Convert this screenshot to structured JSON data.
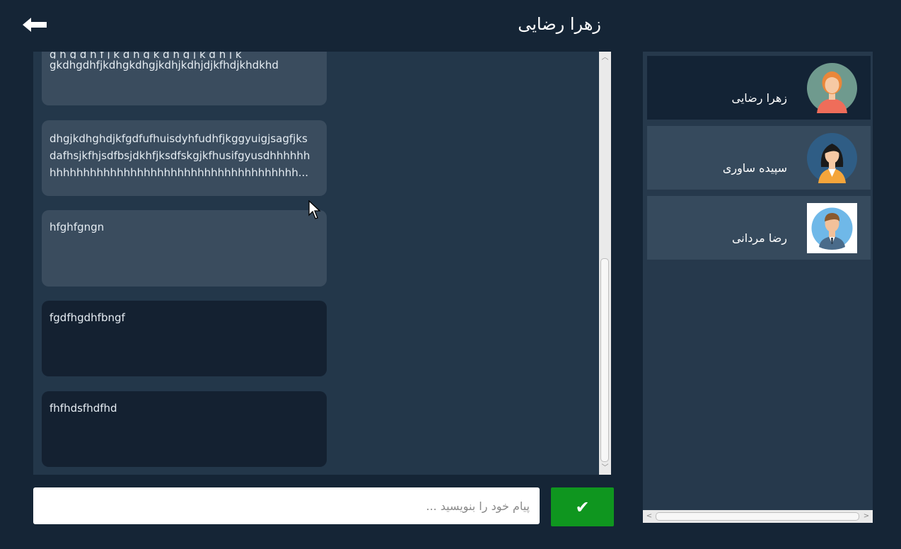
{
  "header": {
    "back_icon": "left-arrow-icon",
    "title": "زهرا رضایی"
  },
  "messages": [
    {
      "direction": "in",
      "text": "gkdhgdhfjkdhgkdhgjkdhjkdhjdjkfhdjkhdkhd"
    },
    {
      "direction": "in",
      "text": "dhgjkdhghdjkfgdfufhuisdyhfudhfjkggyuigjsagfjks\ndafhsjkfhjsdfbsjdkhfjksdfskgjkfhusifgyusdhhhhhh\nhhhhhhhhhhhhhhhhhhhhhhhhhhhhhhhhhhhhh..."
    },
    {
      "direction": "in",
      "text": "hfghfgngn"
    },
    {
      "direction": "out",
      "text": "fgdfhgdhfbngf"
    },
    {
      "direction": "out",
      "text": "fhfhdsfhdfhd"
    }
  ],
  "composer": {
    "placeholder": "پیام خود را بنویسید ...",
    "value": "",
    "send_icon": "checkmark-icon",
    "send_label": "✔"
  },
  "contacts": [
    {
      "name": "زهرا رضایی",
      "avatar": "woman-avatar-icon",
      "active": true
    },
    {
      "name": "سپیده ساوری",
      "avatar": "woman-dark-hair-avatar-icon",
      "active": false
    },
    {
      "name": "رضا مردانی",
      "avatar": "man-avatar-icon",
      "active": false
    }
  ],
  "colors": {
    "background": "#152536",
    "chat_panel": "#23374a",
    "incoming_bubble": "#3a4c5e",
    "outgoing_bubble": "#142131",
    "send_button": "#0f961f",
    "active_contact": "#132335",
    "contact": "#364a5d"
  }
}
